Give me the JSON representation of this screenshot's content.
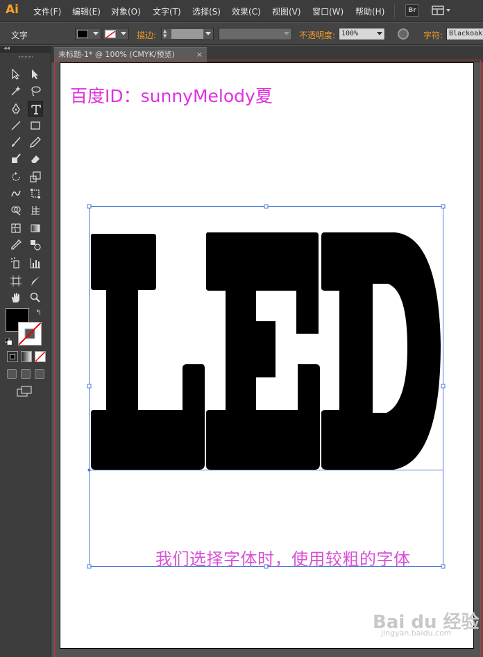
{
  "app": {
    "logo": "Ai",
    "menu": [
      "文件(F)",
      "编辑(E)",
      "对象(O)",
      "文字(T)",
      "选择(S)",
      "效果(C)",
      "视图(V)",
      "窗口(W)",
      "帮助(H)"
    ],
    "bridge_button": "Br",
    "workspace_icon": "workspace-switcher-icon"
  },
  "control_bar": {
    "tool_name": "文字",
    "stroke_label": "描边:",
    "opacity_label": "不透明度:",
    "opacity_value": "100%",
    "character_label": "字符:",
    "font_value": "Blackoak"
  },
  "document": {
    "tab_title": "未标题-1* @ 100% (CMYK/预览)",
    "tab_close": "×"
  },
  "artwork": {
    "main_text": "LED",
    "watermark_text": "百度ID：sunnyMelody夏",
    "caption": "我们选择字体时，使用较粗的字体",
    "colors": {
      "text_fill": "#000000",
      "selection": "#4a78d8",
      "annotation": "#e030e0",
      "brand_orange": "#f7a02a"
    }
  },
  "watermark": {
    "brand": "Bai du 经验",
    "url": "jingyan.baidu.com"
  }
}
